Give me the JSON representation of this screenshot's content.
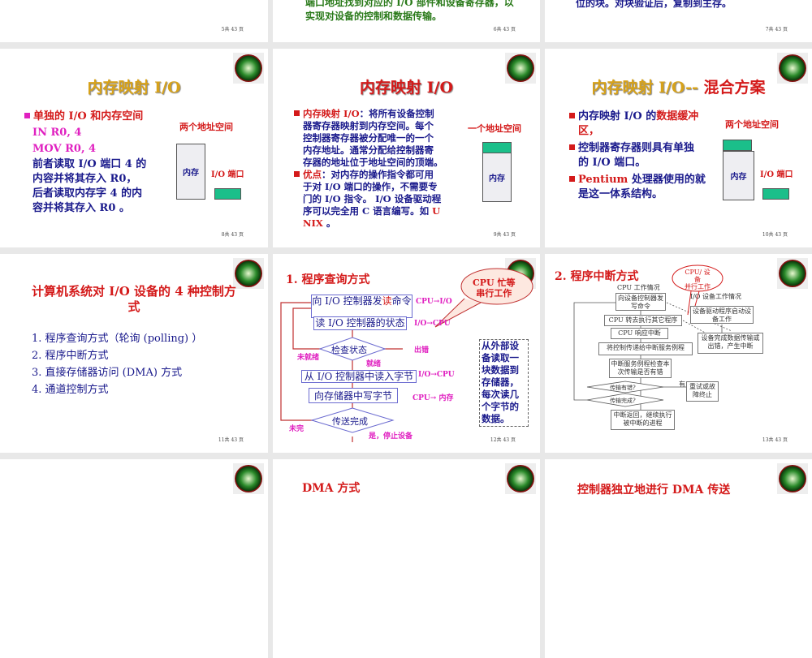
{
  "slides": [
    {
      "page": "5共 43 页"
    },
    {
      "page": "6共 43 页",
      "lines": [
        "端口地址找到对应的 I/O 部件和设备寄存器，以",
        "实现对设备的控制和数据传输。"
      ]
    },
    {
      "page": "7共 43 页",
      "lines": [
        "位的块。对块验证后，复制到主存。"
      ]
    },
    {
      "page": "8共 43 页",
      "title": "内存映射 I/O",
      "bullet": "单独的 I/O 和内存空间",
      "code": [
        "IN  R0, 4",
        "MOV  R0, 4"
      ],
      "text": [
        "前者读取 I/O 端口 4 的",
        "内容并将其存入 R0，",
        "后者读取内存字 4 的内",
        "容并将其存入 R0 。"
      ],
      "diagram_title": "两个地址空间",
      "memory": "内存",
      "io_port": "I/O 端口"
    },
    {
      "page": "9共 43 页",
      "title": "内存映射 I/O",
      "b1_head": "内存映射 I/O",
      "b1": [
        "：将所有设备控制",
        "器寄存器映射到内存空间。每个",
        "控制器寄存器被分配唯一的一个",
        "内存地址。通常分配给控制器寄",
        "存器的地址位于地址空间的顶端。"
      ],
      "b2_head": "优点",
      "b2": [
        "：对内存的操作指令都可用",
        "于对 I/O 端口的操作，不需要专",
        "门的 I/O 指令。 I/O 设备驱动程",
        "序可以完全用 C 语言编写。如 "
      ],
      "b2_u": "U",
      "b2_nix": "NIX",
      "b2_end": " 。",
      "diagram_title": "一个地址空间",
      "memory": "内存"
    },
    {
      "page": "10共 43 页",
      "title_a": "内存映射 I/O--",
      "title_b": " 混合方案",
      "b1a": "内存映射 I/O 的",
      "b1b": "数据缓冲",
      "b1c": "区，",
      "b2": [
        "控制器寄存器则具有单独",
        "的 I/O 端口。"
      ],
      "b3a": "Pentium",
      "b3b": " 处理器使用的就",
      "b3c": "是这一体系结构。",
      "diagram_title": "两个地址空间",
      "memory": "内存",
      "io_port": "I/O 端口"
    },
    {
      "page": "11共 43 页",
      "title": [
        "计算机系统对 I/O 设备的 4 种控制方",
        "式"
      ],
      "items": [
        "1.  程序查询方式（轮询 (polling) ）",
        "2.  程序中断方式",
        "3.  直接存储器访问 (DMA) 方式",
        "4.  通道控制方式"
      ]
    },
    {
      "page": "12共 43 页",
      "title": "1.  程序查询方式",
      "box1a": "向 I/O 控制器发",
      "box1b": "读",
      "box1c": "命令",
      "box2": "读 I/O 控制器的状态",
      "dia1": "检查状态",
      "box3": "从 I/O 控制器中读入字节",
      "box4": "向存储器中写字节",
      "dia2": "传送完成",
      "l_cpu_io": "CPU→I/O",
      "l_io_cpu1": "I/O→CPU",
      "l_err": "出错",
      "l_notready": "未就绪",
      "l_ready": "就绪",
      "l_io_cpu2": "I/O→CPU",
      "l_cpu_mem": "CPU→ 内存",
      "l_notdone": "未完",
      "l_stop": "是，停止设备",
      "callout": [
        "CPU 忙等",
        "串行工作"
      ],
      "note": [
        "从外部设",
        "备读取一",
        "块数据到",
        "存储器，",
        "每次读几",
        "个字节的",
        "数据。"
      ]
    },
    {
      "page": "13共 43 页",
      "title": "2.  程序中断方式",
      "ellipse": [
        "CPU/ 设",
        "备",
        "并行工作"
      ],
      "cpu_head": "CPU 工作情况",
      "io_head": "I/O 设备工作情况",
      "boxes": [
        "向设备控制器发写命令",
        "CPU 转去执行其它程序",
        "CPU 响应中断",
        "将控制传递给中断服务例程",
        "中断服务例程检查本次传输是否有错",
        "中断返回，继续执行被中断的进程"
      ],
      "d1": "传输有错?",
      "d2": "传输完成?",
      "retry": "重试或故障终止",
      "yes": "有",
      "io_boxes": [
        "设备驱动程序启动设备工作",
        "设备完成数据传输或出错，产生中断"
      ]
    },
    {
      "title": ""
    },
    {
      "title": "DMA 方式"
    },
    {
      "title": "控制器独立地进行 DMA 传送"
    }
  ]
}
